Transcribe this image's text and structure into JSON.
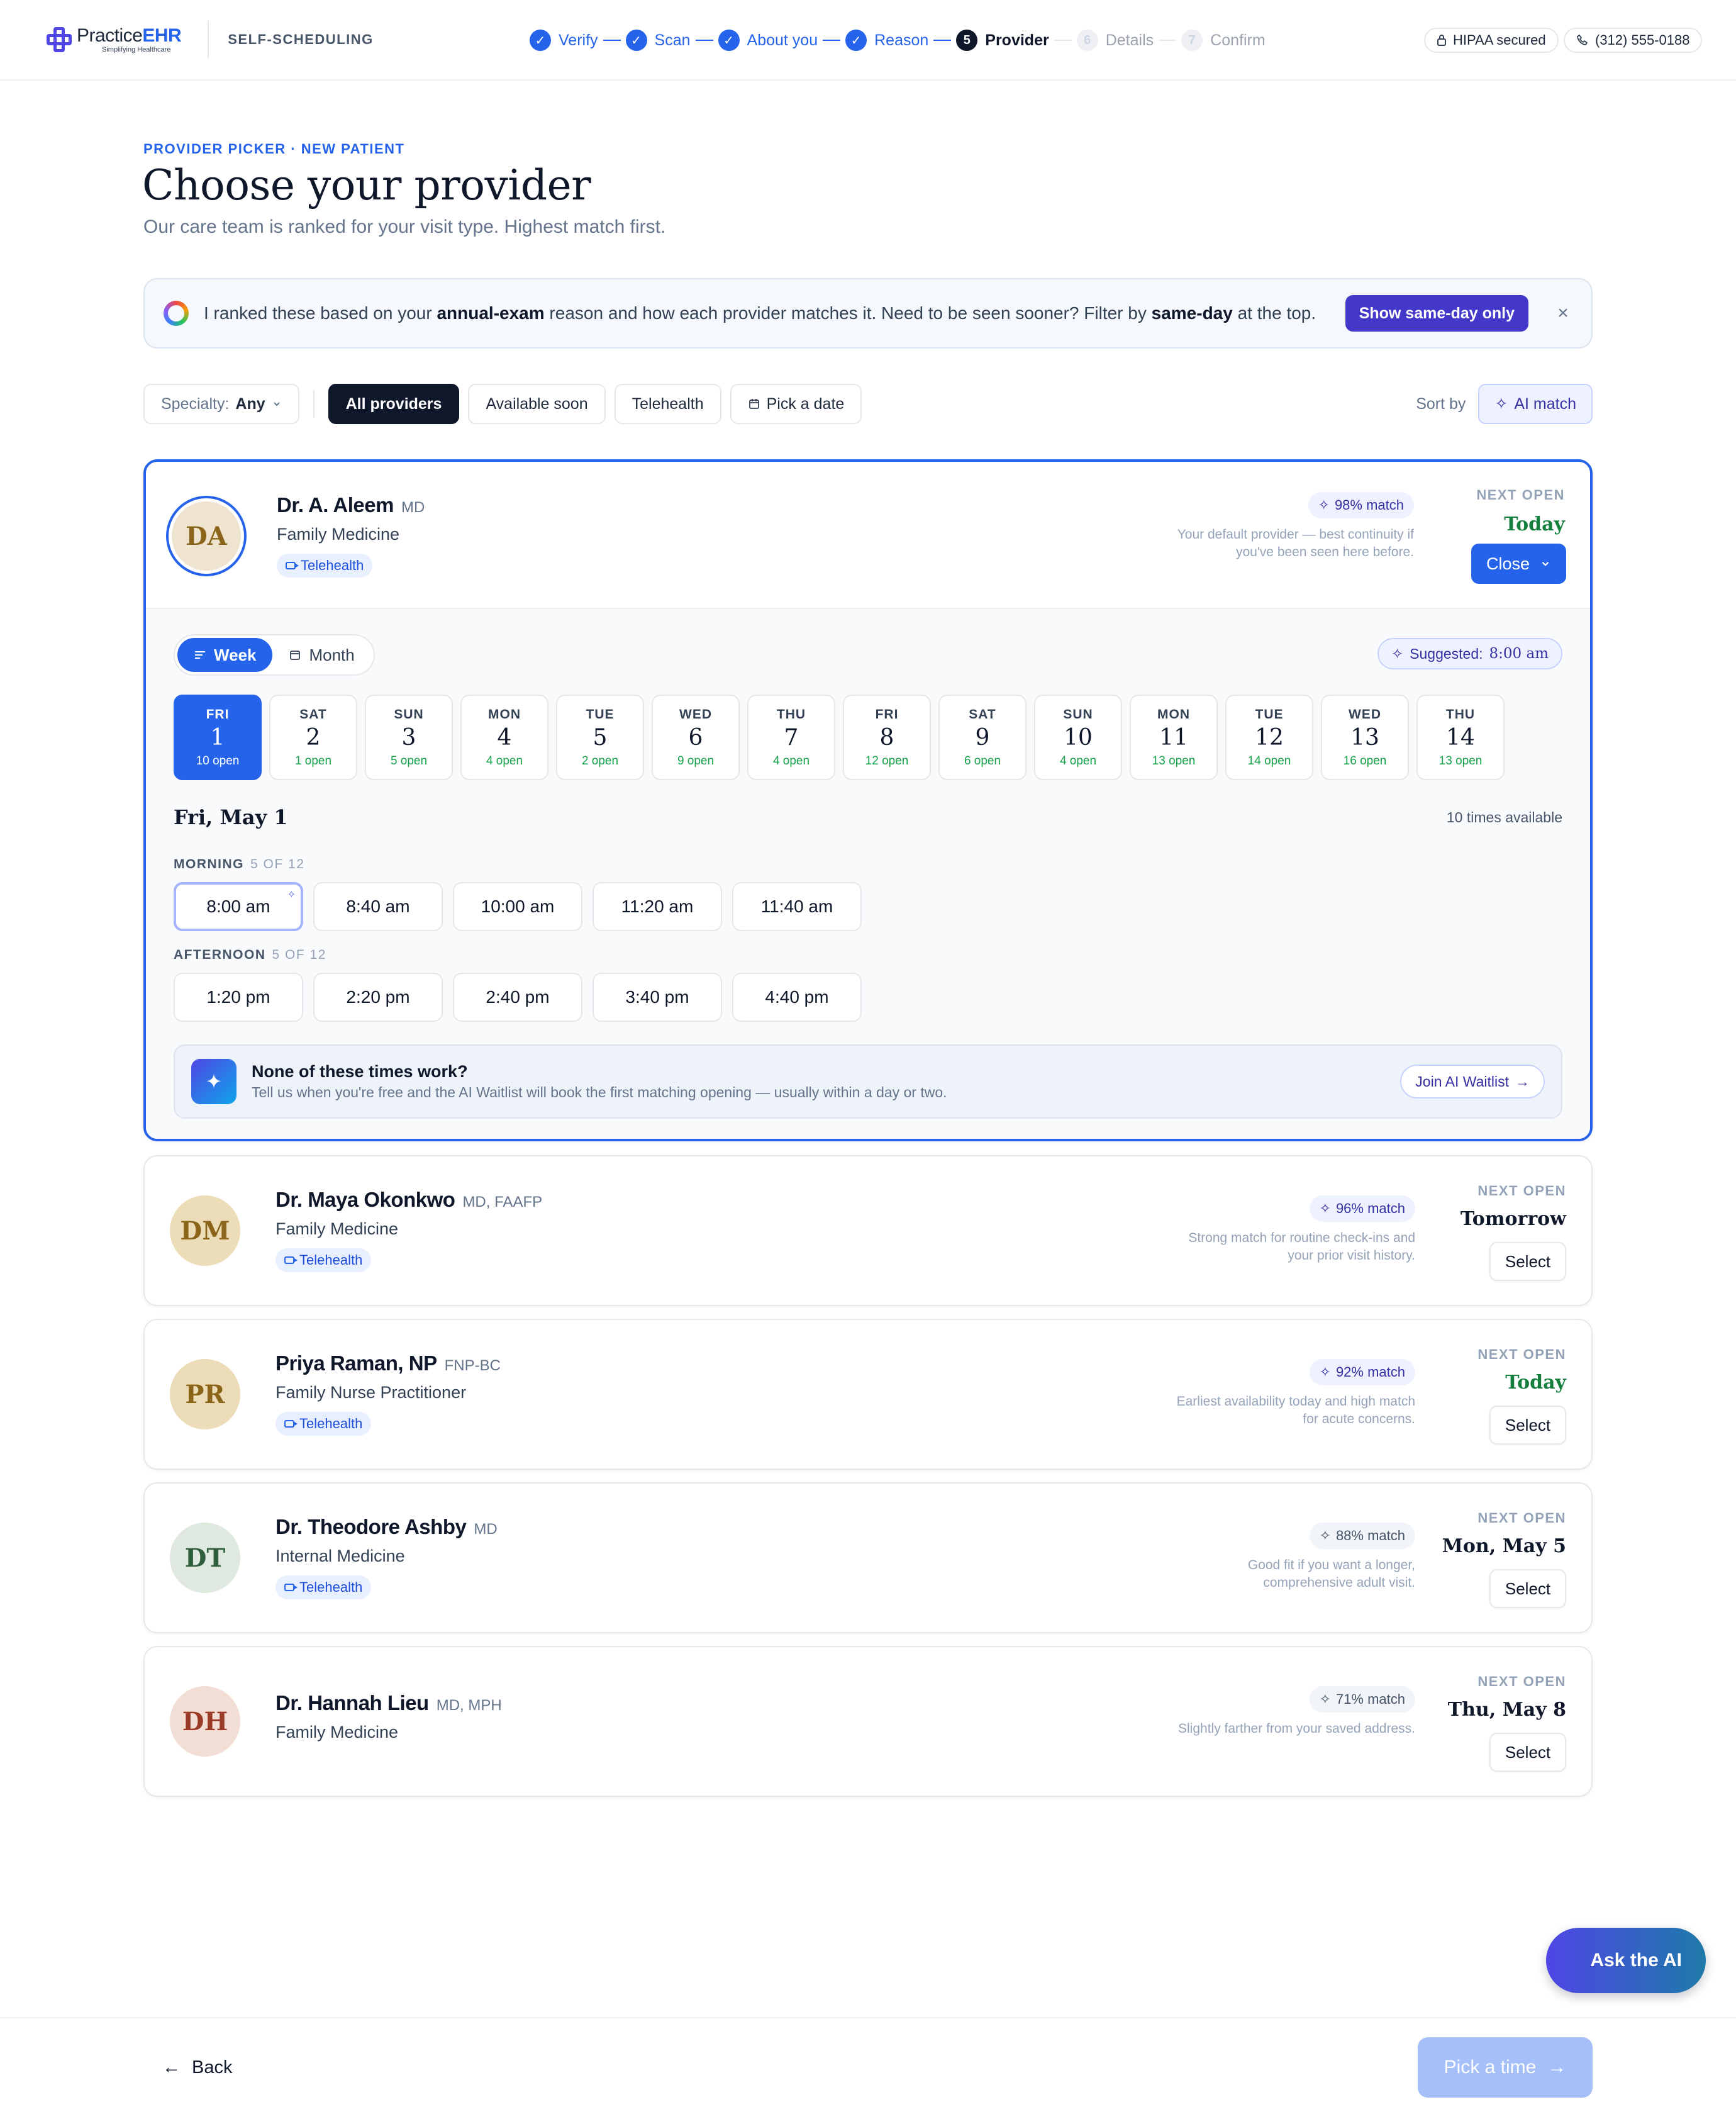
{
  "brand": {
    "name_part1": "Practice",
    "name_part2": "EHR",
    "tagline": "Simplifying Healthcare"
  },
  "app_section": "SELF-SCHEDULING",
  "steps": [
    {
      "num": "1",
      "label": "Verify",
      "state": "done"
    },
    {
      "num": "2",
      "label": "Scan",
      "state": "done"
    },
    {
      "num": "3",
      "label": "About you",
      "state": "done"
    },
    {
      "num": "4",
      "label": "Reason",
      "state": "done"
    },
    {
      "num": "5",
      "label": "Provider",
      "state": "current"
    },
    {
      "num": "6",
      "label": "Details",
      "state": "todo"
    },
    {
      "num": "7",
      "label": "Confirm",
      "state": "todo"
    }
  ],
  "header_badges": {
    "hipaa": "HIPAA secured",
    "phone": "(312) 555-0188"
  },
  "page": {
    "eyebrow": "PROVIDER PICKER · NEW PATIENT",
    "title": "Choose your provider",
    "subtitle": "Our care team is ranked for your visit type. Highest match first."
  },
  "banner": {
    "text_1": "I ranked these based on your ",
    "bold_1": "annual-exam",
    "text_2": " reason and how each provider matches it. Need to be seen sooner? Filter by ",
    "bold_2": "same-day",
    "text_3": " at the top.",
    "button": "Show same-day only",
    "close": "×"
  },
  "filters": {
    "specialty_label": "Specialty:",
    "specialty_value": "Any",
    "chips": [
      "All providers",
      "Available soon",
      "Telehealth",
      "Pick a date"
    ],
    "active_chip": "All providers",
    "sort_label": "Sort by",
    "sort_value": "AI match"
  },
  "providers": [
    {
      "initials": "DA",
      "name": "Dr. A. Aleem",
      "credentials": "MD",
      "specialty": "Family Medicine",
      "telehealth": "Telehealth",
      "match": "98% match",
      "reason": "Your default provider — best continuity if you've been seen here before.",
      "next_label": "NEXT OPEN",
      "next_value": "Today",
      "action": "Close",
      "expanded": true,
      "avatar_bg": "#efe4cf",
      "avatar_fg": "#8a6418"
    },
    {
      "initials": "DM",
      "name": "Dr. Maya Okonkwo",
      "credentials": "MD, FAAFP",
      "specialty": "Family Medicine",
      "telehealth": "Telehealth",
      "match": "96% match",
      "reason": "Strong match for routine check-ins and your prior visit history.",
      "next_label": "NEXT OPEN",
      "next_value": "Tomorrow",
      "action": "Select",
      "avatar_bg": "#ecdcb8",
      "avatar_fg": "#8a6418"
    },
    {
      "initials": "PR",
      "name": "Priya Raman, NP",
      "credentials": "FNP-BC",
      "specialty": "Family Nurse Practitioner",
      "telehealth": "Telehealth",
      "match": "92% match",
      "reason": "Earliest availability today and high match for acute concerns.",
      "next_label": "NEXT OPEN",
      "next_value": "Today",
      "action": "Select",
      "avatar_bg": "#ecdcb8",
      "avatar_fg": "#8a6418"
    },
    {
      "initials": "DT",
      "name": "Dr. Theodore Ashby",
      "credentials": "MD",
      "specialty": "Internal Medicine",
      "telehealth": "Telehealth",
      "match": "88% match",
      "reason": "Good fit if you want a longer, comprehensive adult visit.",
      "next_label": "NEXT OPEN",
      "next_value": "Mon, May 5",
      "action": "Select",
      "avatar_bg": "#dfe9df",
      "avatar_fg": "#2f5e3c"
    },
    {
      "initials": "DH",
      "name": "Dr. Hannah Lieu",
      "credentials": "MD, MPH",
      "specialty": "Family Medicine",
      "match": "71% match",
      "reason": "Slightly farther from your saved address.",
      "next_label": "NEXT OPEN",
      "next_value": "Thu, May 8",
      "action": "Select",
      "avatar_bg": "#f3ded6",
      "avatar_fg": "#9a3b28"
    }
  ],
  "calendar": {
    "views": [
      "Week",
      "Month"
    ],
    "active_view": "Week",
    "suggested_label": "Suggested:",
    "suggested_time": "8:00 am",
    "days": [
      {
        "dow": "FRI",
        "num": "1",
        "open": "10 open",
        "selected": true
      },
      {
        "dow": "SAT",
        "num": "2",
        "open": "1 open"
      },
      {
        "dow": "SUN",
        "num": "3",
        "open": "5 open"
      },
      {
        "dow": "MON",
        "num": "4",
        "open": "4 open"
      },
      {
        "dow": "TUE",
        "num": "5",
        "open": "2 open"
      },
      {
        "dow": "WED",
        "num": "6",
        "open": "9 open"
      },
      {
        "dow": "THU",
        "num": "7",
        "open": "4 open"
      },
      {
        "dow": "FRI",
        "num": "8",
        "open": "12 open"
      },
      {
        "dow": "SAT",
        "num": "9",
        "open": "6 open"
      },
      {
        "dow": "SUN",
        "num": "10",
        "open": "4 open"
      },
      {
        "dow": "MON",
        "num": "11",
        "open": "13 open"
      },
      {
        "dow": "TUE",
        "num": "12",
        "open": "14 open"
      },
      {
        "dow": "WED",
        "num": "13",
        "open": "16 open"
      },
      {
        "dow": "THU",
        "num": "14",
        "open": "13 open"
      }
    ],
    "selected_date": "Fri, May 1",
    "times_available": "10 times available",
    "morning": {
      "label": "MORNING",
      "count": "5 OF 12",
      "slots": [
        "8:00 am",
        "8:40 am",
        "10:00 am",
        "11:20 am",
        "11:40 am"
      ]
    },
    "afternoon": {
      "label": "AFTERNOON",
      "count": "5 OF 12",
      "slots": [
        "1:20 pm",
        "2:20 pm",
        "2:40 pm",
        "3:40 pm",
        "4:40 pm"
      ]
    },
    "waitlist": {
      "title": "None of these times work?",
      "desc": "Tell us when you're free and the AI Waitlist will book the first matching opening — usually within a day or two.",
      "button": "Join AI Waitlist"
    }
  },
  "ask_ai": "Ask the AI",
  "footer": {
    "back": "Back",
    "next": "Pick a time"
  },
  "colors": {
    "primary": "#2563eb",
    "ai_indigo": "#4338ca",
    "open_green": "#16a34a"
  }
}
